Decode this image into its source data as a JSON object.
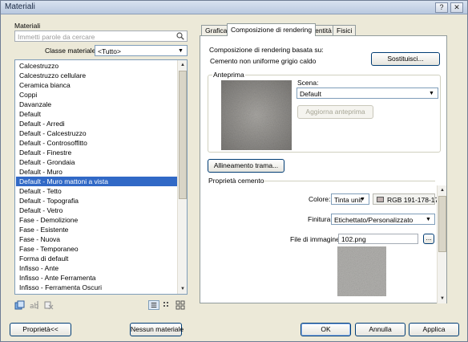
{
  "window": {
    "title": "Materiali",
    "help_glyph": "?",
    "close_glyph": "✕"
  },
  "left": {
    "section_label": "Materiali",
    "search_placeholder": "Immetti parole da cercare",
    "class_label": "Classe materiale:",
    "class_value": "<Tutto>",
    "selected_index": 12,
    "items": [
      "Calcestruzzo",
      "Calcestruzzo cellulare",
      "Ceramica bianca",
      "Coppi",
      "Davanzale",
      "Default",
      "Default - Arredi",
      "Default - Calcestruzzo",
      "Default - Controsoffitto",
      "Default - Finestre",
      "Default - Grondaia",
      "Default - Muro",
      "Default - Muro mattoni a vista",
      "Default - Tetto",
      "Default - Topografia",
      "Default - Vetro",
      "Fase - Demolizione",
      "Fase - Esistente",
      "Fase - Nuova",
      "Fase - Temporaneo",
      "Forma di default",
      "Infisso - Ante",
      "Infisso - Ante Ferramenta",
      "Infisso - Ferramenta Oscuri"
    ]
  },
  "tabs": [
    "Grafica",
    "Composizione di rendering",
    "Identità",
    "Fisici"
  ],
  "active_tab": 1,
  "rendering": {
    "based_on_title": "Composizione di rendering basata su:",
    "based_on_value": "Cemento non uniforme grigio caldo",
    "replace_button": "Sostituisci...",
    "preview_title": "Anteprima",
    "scene_label": "Scena:",
    "scene_value": "Default",
    "update_preview_button": "Aggiorna anteprima",
    "texture_align_button": "Allineamento trama...",
    "properties_title": "Proprietà cemento",
    "color_label": "Colore:",
    "color_mode": "Tinta unit",
    "color_rgb": "RGB 191-178-17",
    "finish_label": "Finitura:",
    "finish_value": "Etichettato/Personalizzato",
    "image_file_label": "File di immagine:",
    "image_file_value": "102.png",
    "browse_button": "..."
  },
  "footer": {
    "properties_button": "Proprietà<<",
    "no_material_button": "Nessun materiale",
    "ok_button": "OK",
    "cancel_button": "Annulla",
    "apply_button": "Applica"
  },
  "colors": {
    "selection": "#3169c6",
    "dialog_bg": "#ece9d8"
  }
}
